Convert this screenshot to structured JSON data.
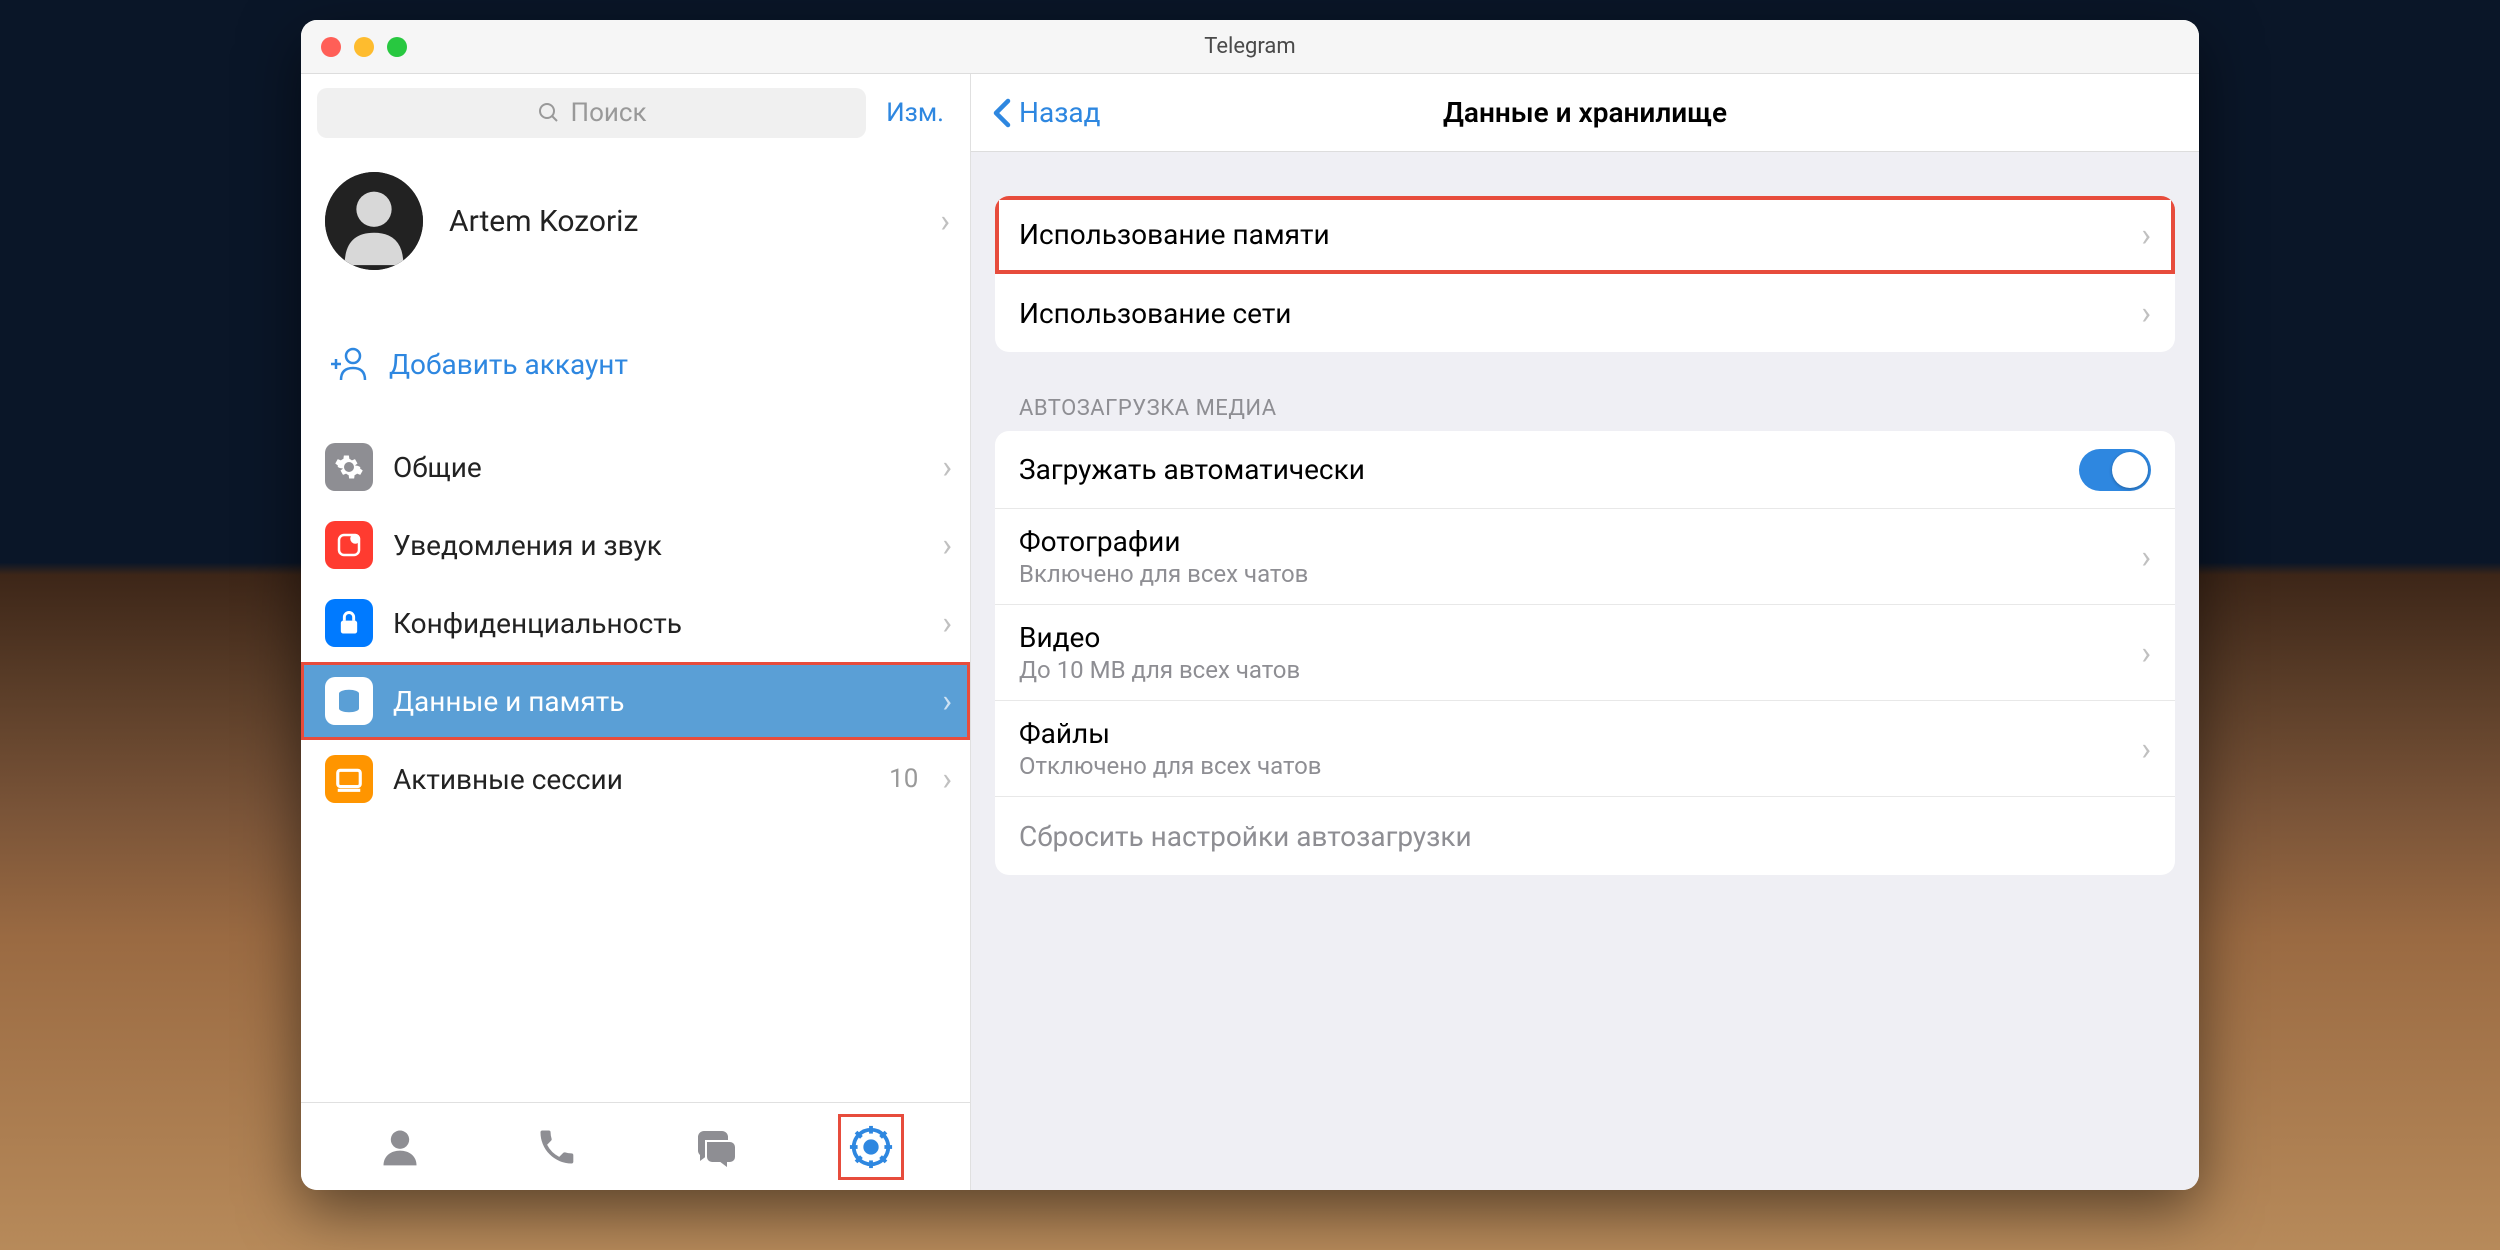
{
  "window": {
    "title": "Telegram"
  },
  "sidebar": {
    "search_placeholder": "Поиск",
    "edit_label": "Изм.",
    "profile_name": "Artem Kozoriz",
    "add_account_label": "Добавить аккаунт",
    "items": [
      {
        "label": "Общие"
      },
      {
        "label": "Уведомления и звук"
      },
      {
        "label": "Конфиденциальность"
      },
      {
        "label": "Данные и память"
      },
      {
        "label": "Активные сессии",
        "badge": "10"
      }
    ]
  },
  "main": {
    "back_label": "Назад",
    "title": "Данные и хранилище",
    "usage": {
      "storage": "Использование памяти",
      "network": "Использование сети"
    },
    "autoload": {
      "section_title": "АВТОЗАГРУЗКА МЕДИА",
      "autodl": "Загружать автоматически",
      "photos_label": "Фотографии",
      "photos_sub": "Включено для всех чатов",
      "videos_label": "Видео",
      "videos_sub": "До 10 MB для всех чатов",
      "files_label": "Файлы",
      "files_sub": "Отключено для всех чатов",
      "reset": "Сбросить настройки автозагрузки"
    }
  }
}
